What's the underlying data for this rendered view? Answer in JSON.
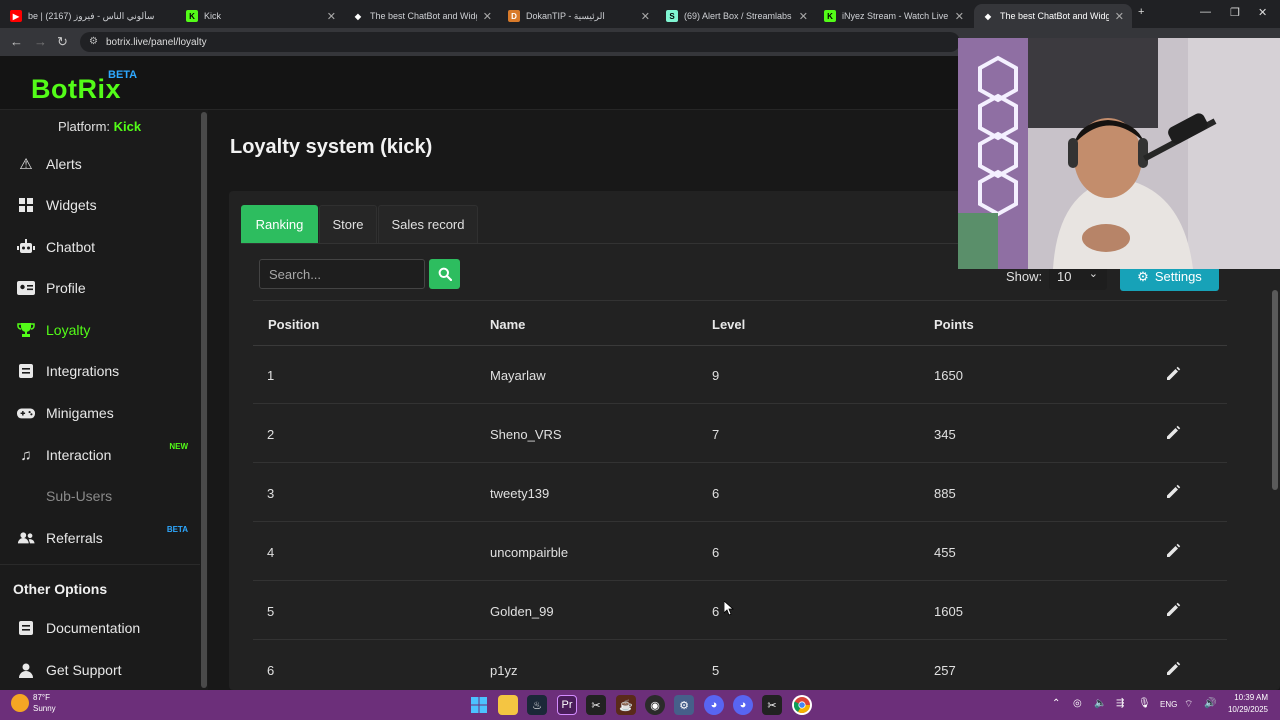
{
  "browser": {
    "tabs": [
      {
        "title": "be | سألوني الناس - فيروز (2167)",
        "active": false,
        "icon": "youtube-icon"
      },
      {
        "title": "Kick",
        "active": false,
        "icon": "kick-icon"
      },
      {
        "title": "The best ChatBot and Widgets",
        "active": false,
        "icon": "botrix-icon"
      },
      {
        "title": "DokanTIP - الرئيسية",
        "active": false,
        "icon": "dokantip-icon"
      },
      {
        "title": "(69) Alert Box / Streamlabs",
        "active": false,
        "icon": "streamlabs-icon"
      },
      {
        "title": "iNyez Stream - Watch Live on K",
        "active": false,
        "icon": "kick-icon"
      },
      {
        "title": "The best ChatBot and Widgets",
        "active": true,
        "icon": "botrix-icon"
      }
    ],
    "url": "botrix.live/panel/loyalty"
  },
  "app": {
    "logo": "BotRix",
    "logo_badge": "BETA",
    "brand_color": "#53fc18"
  },
  "sidebar": {
    "platform_label": "Platform:",
    "platform_value": "Kick",
    "items": [
      {
        "label": "Alerts",
        "icon": "warning-icon",
        "badge": ""
      },
      {
        "label": "Widgets",
        "icon": "grid-icon",
        "badge": ""
      },
      {
        "label": "Chatbot",
        "icon": "robot-icon",
        "badge": ""
      },
      {
        "label": "Profile",
        "icon": "id-card-icon",
        "badge": ""
      },
      {
        "label": "Loyalty",
        "icon": "trophy-icon",
        "badge": "",
        "active": true
      },
      {
        "label": "Integrations",
        "icon": "plug-icon",
        "badge": ""
      },
      {
        "label": "Minigames",
        "icon": "gamepad-icon",
        "badge": ""
      },
      {
        "label": "Interaction",
        "icon": "music-icon",
        "badge": "NEW"
      },
      {
        "label": "Sub-Users",
        "icon": "",
        "badge": "",
        "disabled": true
      },
      {
        "label": "Referrals",
        "icon": "users-icon",
        "badge": "BETA"
      }
    ],
    "other_options_title": "Other Options",
    "other_items": [
      {
        "label": "Documentation",
        "icon": "book-icon"
      },
      {
        "label": "Get Support",
        "icon": "support-icon"
      }
    ]
  },
  "main": {
    "title": "Loyalty system (kick)",
    "tabs": [
      "Ranking",
      "Store",
      "Sales record"
    ],
    "active_tab": 0,
    "search_placeholder": "Search...",
    "show_label": "Show:",
    "show_value": "10",
    "settings_label": "Settings",
    "columns": [
      "Position",
      "Name",
      "Level",
      "Points"
    ],
    "rows": [
      {
        "position": "1",
        "name": "Mayarlaw",
        "level": "9",
        "points": "1650"
      },
      {
        "position": "2",
        "name": "Sheno_VRS",
        "level": "7",
        "points": "345"
      },
      {
        "position": "3",
        "name": "tweety139",
        "level": "6",
        "points": "885"
      },
      {
        "position": "4",
        "name": "uncompairble",
        "level": "6",
        "points": "455"
      },
      {
        "position": "5",
        "name": "Golden_99",
        "level": "6",
        "points": "1605"
      },
      {
        "position": "6",
        "name": "p1yz",
        "level": "5",
        "points": "257"
      }
    ]
  },
  "taskbar": {
    "weather_temp": "87°F",
    "weather_condition": "Sunny",
    "language": "ENG",
    "time": "10:39 AM",
    "date": "10/29/2025"
  }
}
